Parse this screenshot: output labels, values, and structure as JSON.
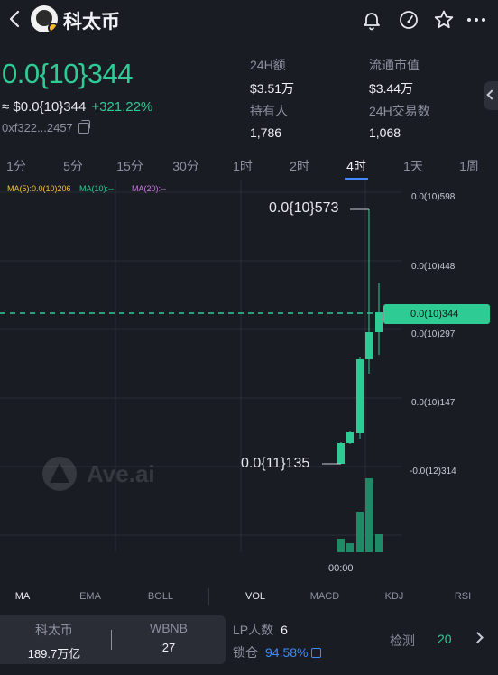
{
  "header": {
    "title": "科太币"
  },
  "price": {
    "main": "0.0{10}344",
    "usd": "≈ $0.0{10}344",
    "change": "+321.22%",
    "contract": "0xf322...2457"
  },
  "stats": {
    "volume_24h": {
      "label": "24H额",
      "value": "$3.51万"
    },
    "market_cap": {
      "label": "流通市值",
      "value": "$3.44万"
    },
    "holders": {
      "label": "持有人",
      "value": "1,786"
    },
    "tx_24h": {
      "label": "24H交易数",
      "value": "1,068"
    }
  },
  "timeframes": [
    "1分",
    "5分",
    "15分",
    "30分",
    "1时",
    "2时",
    "4时",
    "1天",
    "1周"
  ],
  "active_timeframe": "4时",
  "ma_legend": {
    "ma5": "MA(5):0.0(10)206",
    "ma10": "MA(10):--",
    "ma20": "MA(20):--"
  },
  "price_axis": [
    "0.0(10)598",
    "0.0(10)448",
    "0.0(10)344",
    "0.0(10)297",
    "0.0(10)147",
    "-0.0(12)314"
  ],
  "annotations": {
    "high": "0.0{10}573",
    "low": "0.0{11}135"
  },
  "watermark": "Ave.ai",
  "time_label": "00:00",
  "indicators": {
    "left": [
      "MA",
      "EMA",
      "BOLL"
    ],
    "right": [
      "VOL",
      "MACD",
      "KDJ",
      "RSI"
    ],
    "active": [
      "MA",
      "VOL"
    ]
  },
  "pool": {
    "token_label": "科太币",
    "token_value": "189.7万亿",
    "base_label": "WBNB",
    "base_value": "27"
  },
  "lp": {
    "count_label": "LP人数",
    "count_value": "6",
    "lock_label": "锁仓",
    "lock_value": "94.58%"
  },
  "check": {
    "label": "检测",
    "count": "20"
  },
  "colors": {
    "up": "#2ecc94",
    "accent": "#3d8bff",
    "background": "#1a1c24",
    "ma5": "#f3c13a",
    "ma10": "#2ecc94",
    "ma20": "#c77ddf"
  },
  "chart_data": {
    "type": "candlestick",
    "price_axis_ticks": [
      "0.0(10)598",
      "0.0(10)448",
      "0.0(10)344",
      "0.0(10)297",
      "0.0(10)147",
      "-0.0(12)314"
    ],
    "current_price": "0.0(10)344",
    "time_ticks": [
      "00:00"
    ],
    "candles_close_relative": [
      0.135,
      0.147,
      0.21,
      0.28,
      0.297,
      0.344
    ],
    "volume_relative": [
      0.15,
      0.15,
      0.55,
      1.0,
      0.25
    ]
  }
}
